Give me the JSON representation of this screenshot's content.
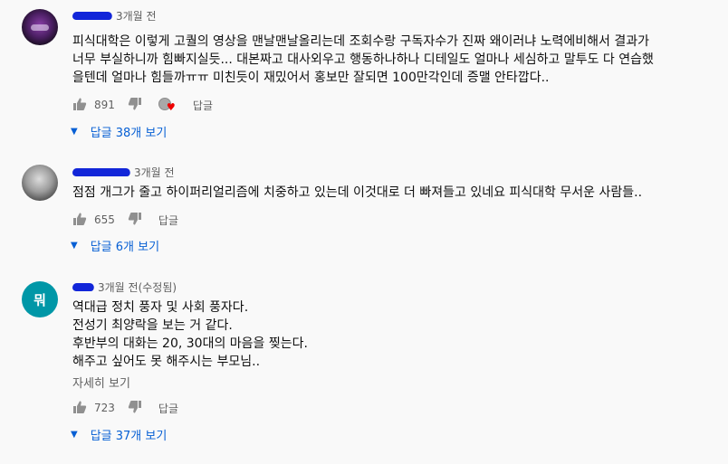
{
  "colors": {
    "link": "#065fd4",
    "meta": "#606060",
    "scribble": "#1226d9",
    "teal_avatar": "#0097a7"
  },
  "comments": [
    {
      "avatar_icon": "user-photo-icon",
      "time": "3개월 전",
      "text": "피식대학은 이렇게 고퀄의 영상을 맨날맨날올리는데 조회수랑 구독자수가 진짜 왜이러냐 노력에비해서 결과가\n너무 부실하니까 힘빠지실듯... 대본짜고 대사외우고 행동하나하나 디테일도 얼마나 세심하고 말투도 다 연습했\n을텐데 얼마나 힘들까ㅠㅠ 미친듯이 재밌어서 홍보만 잘되면 100만각인데 증맬 안타깝다..",
      "likes": "891",
      "reply_label": "답글",
      "replies_label": "답글 38개 보기"
    },
    {
      "avatar_icon": "user-photo-icon",
      "time": "3개월 전",
      "text": "점점 개그가 줄고 하이퍼리얼리즘에 치중하고 있는데 이것대로 더 빠져들고 있네요 피식대학 무서운 사람들..",
      "likes": "655",
      "reply_label": "답글",
      "replies_label": "답글 6개 보기"
    },
    {
      "avatar_letter": "뭐",
      "time": "3개월 전(수정됨)",
      "text": "역대급 정치 풍자 및 사회 풍자다.\n전성기 최양락을 보는 거 같다.\n후반부의 대화는 20, 30대의 마음을 찢는다.\n해주고 싶어도 못 해주시는 부모님..",
      "read_more": "자세히 보기",
      "likes": "723",
      "reply_label": "답글",
      "replies_label": "답글 37개 보기"
    }
  ]
}
